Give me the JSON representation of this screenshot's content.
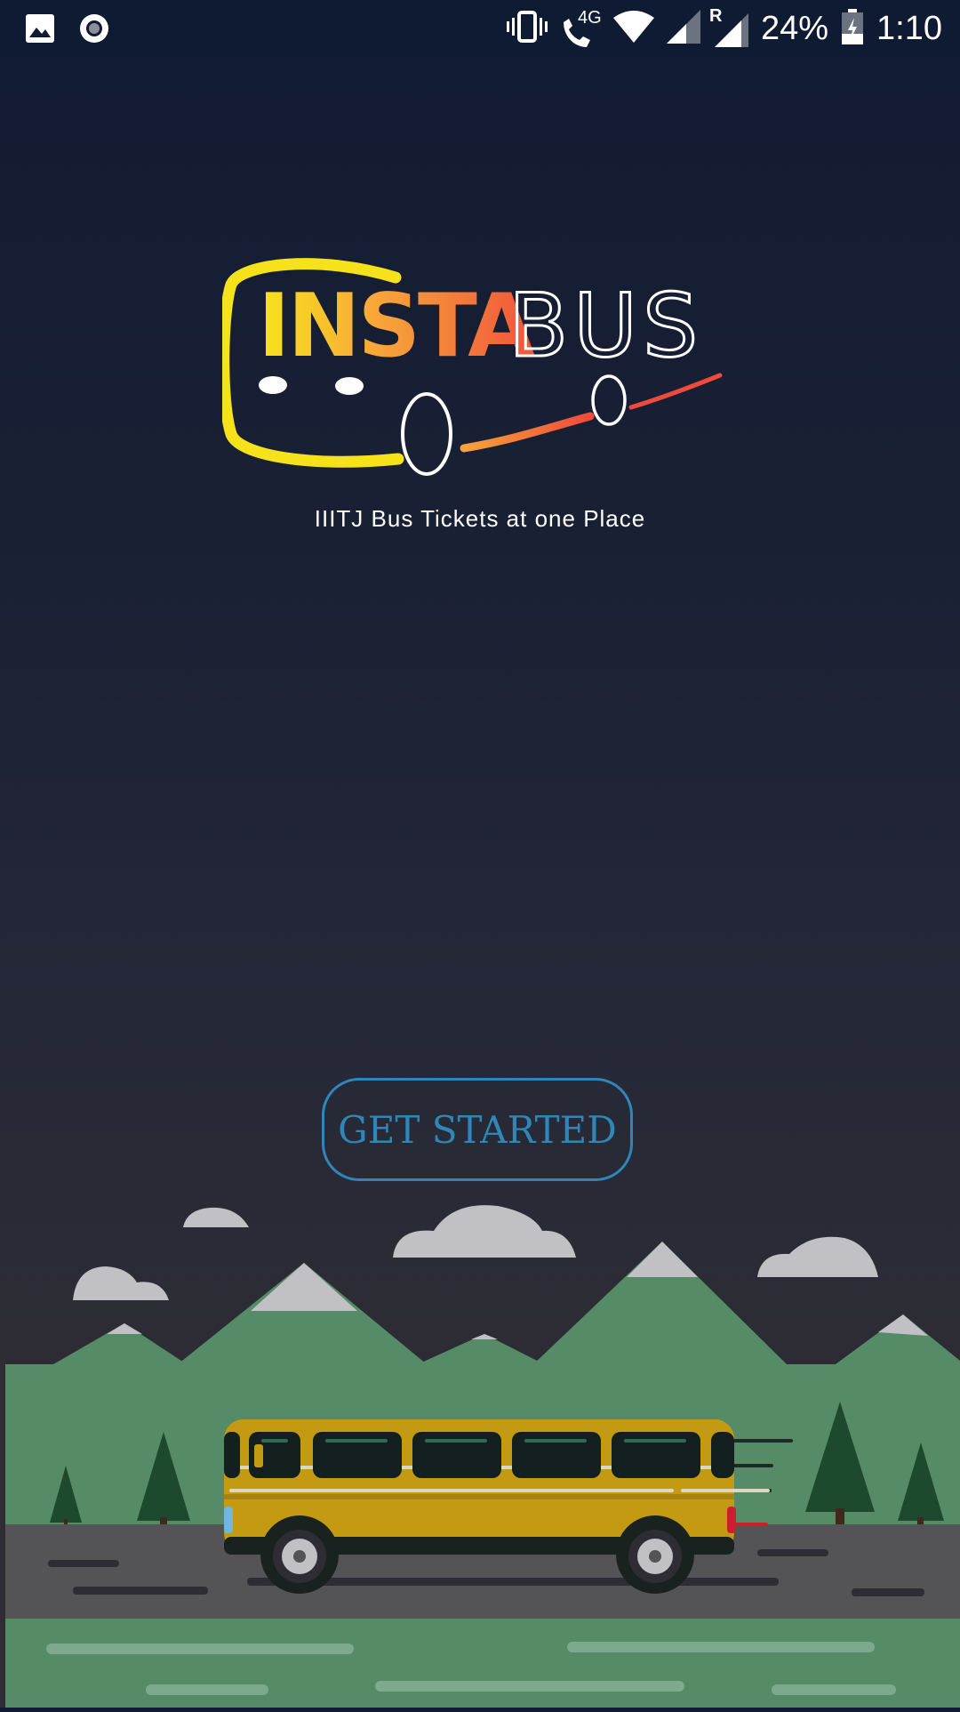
{
  "status_bar": {
    "network": "4G",
    "roaming": "R",
    "battery": "24%",
    "time": "1:10"
  },
  "logo": {
    "part1": "INSTA",
    "part2": "BUS"
  },
  "tagline": "IIITJ Bus Tickets at one Place",
  "button": {
    "label": "GET STARTED"
  },
  "colors": {
    "accent": "#2f86b8",
    "bus_yellow": "#c49a13",
    "grass": "#558c67",
    "road": "#545456"
  }
}
